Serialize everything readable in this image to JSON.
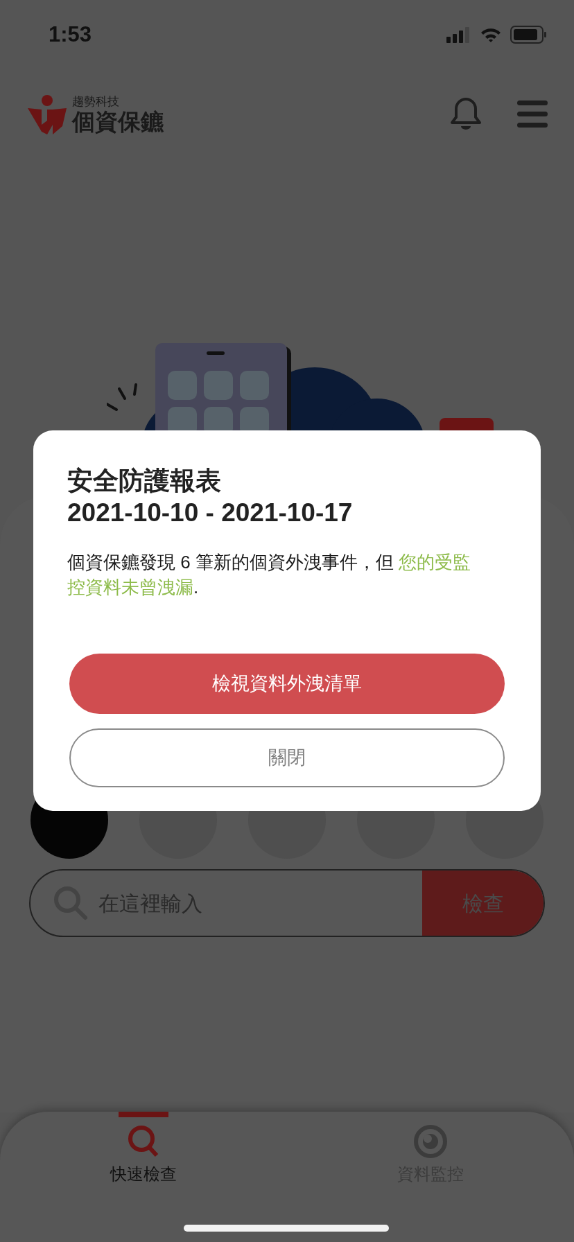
{
  "status_bar": {
    "time": "1:53"
  },
  "header": {
    "brand_small": "趨勢科技",
    "brand": "個資保鑣"
  },
  "categories": [
    {
      "selected": true
    },
    {
      "selected": false
    },
    {
      "selected": false
    },
    {
      "selected": false
    },
    {
      "selected": false
    }
  ],
  "search": {
    "placeholder": "在這裡輸入",
    "button": "檢查"
  },
  "tabs": [
    {
      "label": "快速檢查",
      "selected": true
    },
    {
      "label": "資料監控",
      "selected": false
    }
  ],
  "dialog": {
    "title": "安全防護報表",
    "date_range": "2021-10-10 - 2021-10-17",
    "message": "個資保鑣發現 6 筆新的個資外洩事件，但 ",
    "highlight": "您的受監控資料未曾洩漏",
    "message_end": ".",
    "primary_button": "檢視資料外洩清單",
    "close_button": "關閉"
  }
}
